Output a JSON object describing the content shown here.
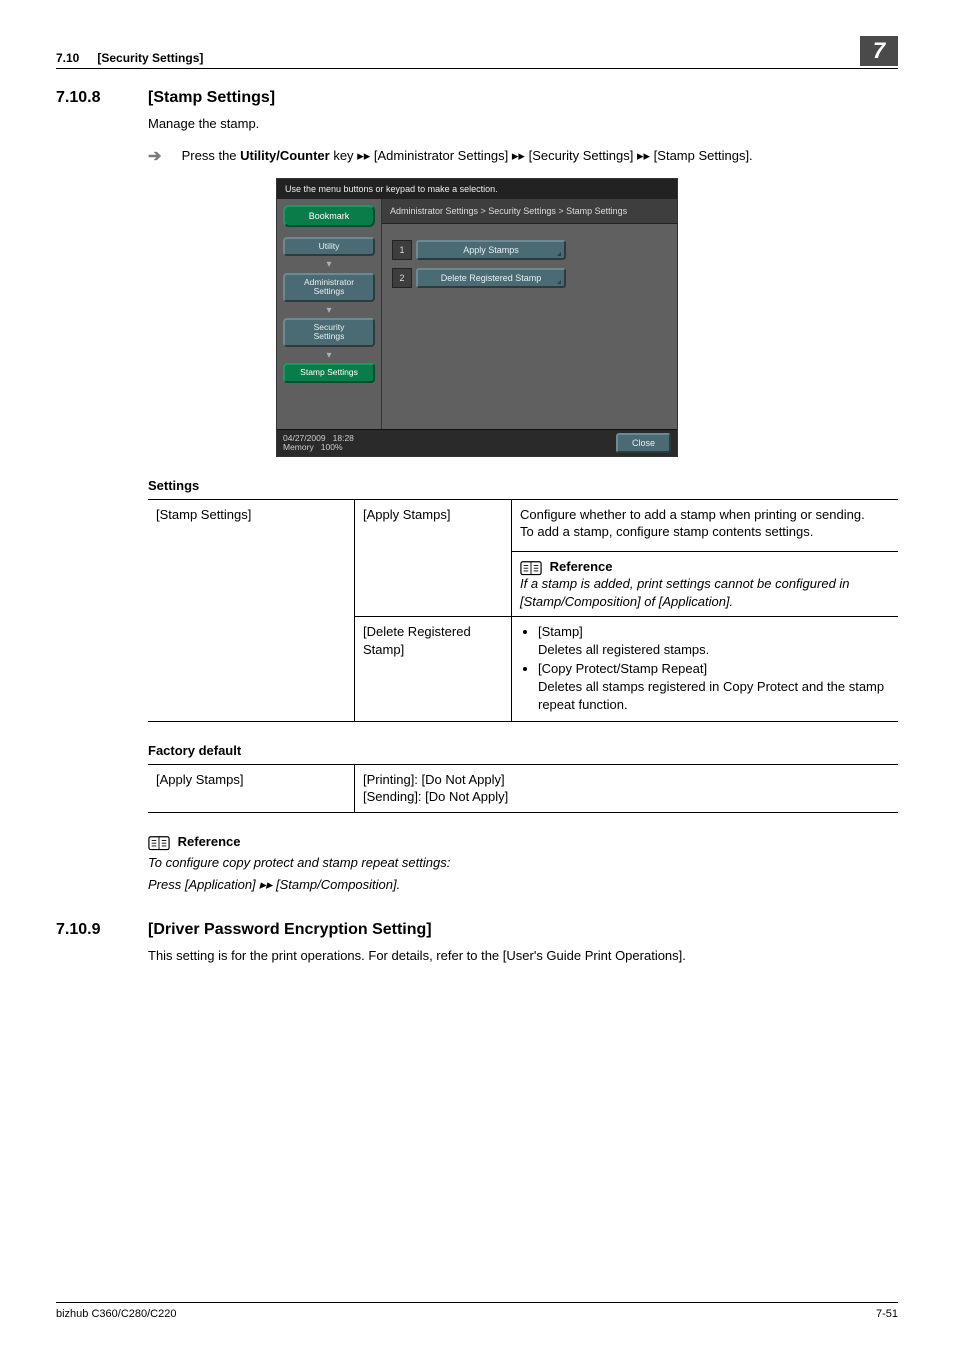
{
  "header": {
    "num": "7.10",
    "title": "[Security Settings]",
    "chapter": "7"
  },
  "section_a": {
    "num": "7.10.8",
    "title": "[Stamp Settings]",
    "intro": "Manage the stamp.",
    "step_prefix": "Press the ",
    "step_bold": "Utility/Counter",
    "step_mid": " key ",
    "path1": "[Administrator Settings]",
    "path2": "[Security Settings]",
    "path3": "[Stamp Settings]."
  },
  "screenshot": {
    "top_text": "Use the menu buttons or keypad to make a selection.",
    "bookmark": "Bookmark",
    "crumbs": [
      "Utility",
      "Administrator\nSettings",
      "Security\nSettings",
      "Stamp Settings"
    ],
    "path": "Administrator Settings > Security Settings > Stamp Settings",
    "items": [
      {
        "n": "1",
        "label": "Apply Stamps"
      },
      {
        "n": "2",
        "label": "Delete Registered Stamp"
      }
    ],
    "date": "04/27/2009",
    "time": "18:28",
    "memory_label": "Memory",
    "memory_val": "100%",
    "close": "Close"
  },
  "settings_heading": "Settings",
  "settings_table": {
    "r1c1": "[Stamp Settings]",
    "r1c2": "[Apply Stamps]",
    "r1c3a": "Configure whether to add a stamp when printing or sending.",
    "r1c3b": "To add a stamp, configure stamp contents settings.",
    "r1_ref_label": "Reference",
    "r1_ref_note": "If a stamp is added, print settings cannot be configured in [Stamp/Composition] of [Application].",
    "r2c2": "[Delete Registered Stamp]",
    "r2_b1a": "[Stamp]",
    "r2_b1b": "Deletes all registered stamps.",
    "r2_b2a": "[Copy Protect/Stamp Repeat]",
    "r2_b2b": "Deletes all stamps registered in Copy Protect and the stamp repeat function."
  },
  "factory_heading": "Factory default",
  "factory_table": {
    "c1": "[Apply Stamps]",
    "c2a": "[Printing]: [Do Not Apply]",
    "c2b": "[Sending]: [Do Not Apply]"
  },
  "reference_block": {
    "label": "Reference",
    "line1": "To configure copy protect and stamp repeat settings:",
    "line2_a": "Press [Application] ",
    "line2_b": " [Stamp/Composition]."
  },
  "section_b": {
    "num": "7.10.9",
    "title": "[Driver Password Encryption Setting]",
    "body": "This setting is for the print operations. For details, refer to the [User's Guide Print Operations]."
  },
  "footer": {
    "left": "bizhub C360/C280/C220",
    "right": "7-51"
  }
}
